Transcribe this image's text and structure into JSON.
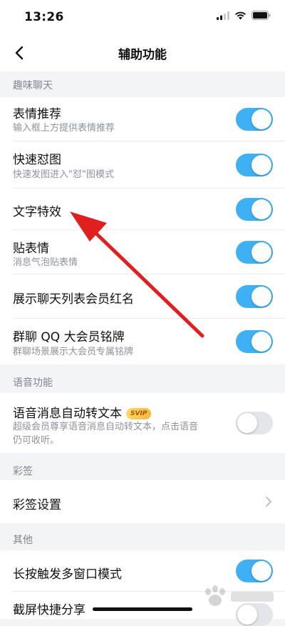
{
  "status_bar": {
    "time": "13:26"
  },
  "nav": {
    "title": "辅助功能"
  },
  "sections": [
    {
      "header": "趣味聊天"
    },
    {
      "header": "语音功能"
    },
    {
      "header": "彩签"
    },
    {
      "header": "其他"
    }
  ],
  "rows": {
    "emoji_recommend": {
      "title": "表情推荐",
      "subtitle": "输入框上方提供表情推荐",
      "state": "on"
    },
    "quick_image": {
      "title": "快速怼图",
      "subtitle": "快速发图进入\"怼\"图模式",
      "state": "on"
    },
    "text_effects": {
      "title": "文字特效",
      "state": "on"
    },
    "sticker": {
      "title": "贴表情",
      "subtitle": "消息气泡贴表情",
      "state": "on"
    },
    "member_red_name": {
      "title": "展示聊天列表会员红名",
      "state": "on"
    },
    "group_badge": {
      "title": "群聊 QQ 大会员铭牌",
      "subtitle": "群聊场景展示大会员专属铭牌",
      "state": "on"
    },
    "voice_to_text": {
      "title": "语音消息自动转文本",
      "badge": "SVIP",
      "subtitle_line1": "超级会员尊享语音消息自动转文本，点击语音",
      "subtitle_line2": "仍可收听。",
      "state": "off"
    },
    "caiqian_settings": {
      "title": "彩签设置"
    },
    "multi_window": {
      "title": "长按触发多窗口模式",
      "state": "on"
    },
    "screenshot_share": {
      "title": "截屏快捷分享",
      "state": "off"
    }
  },
  "colors": {
    "toggle_on": "#3fb0f3",
    "toggle_off": "#e3e5ea",
    "annotation_arrow": "#e0201e"
  }
}
